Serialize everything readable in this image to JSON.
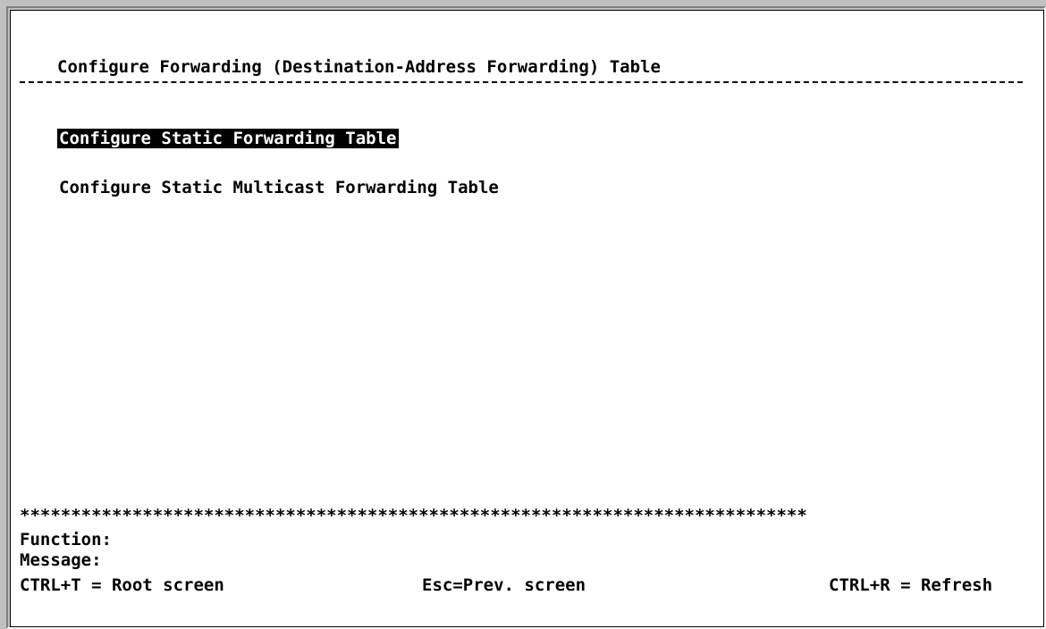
{
  "header": {
    "title": "Configure Forwarding (Destination-Address Forwarding) Table"
  },
  "menu": {
    "items": [
      {
        "label": "Configure Static Forwarding Table",
        "selected": true
      },
      {
        "label": "Configure Static Multicast Forwarding Table",
        "selected": false
      }
    ]
  },
  "footer": {
    "separator": "*****************************************************************************",
    "function_label": "Function:",
    "message_label": "Message:",
    "hints": {
      "root": "CTRL+T = Root screen",
      "prev": "Esc=Prev. screen",
      "refresh": "CTRL+R = Refresh"
    }
  },
  "colors": {
    "background": "#ffffff",
    "text": "#000000",
    "highlight": "#000000",
    "frame": "#c0c0c0"
  }
}
